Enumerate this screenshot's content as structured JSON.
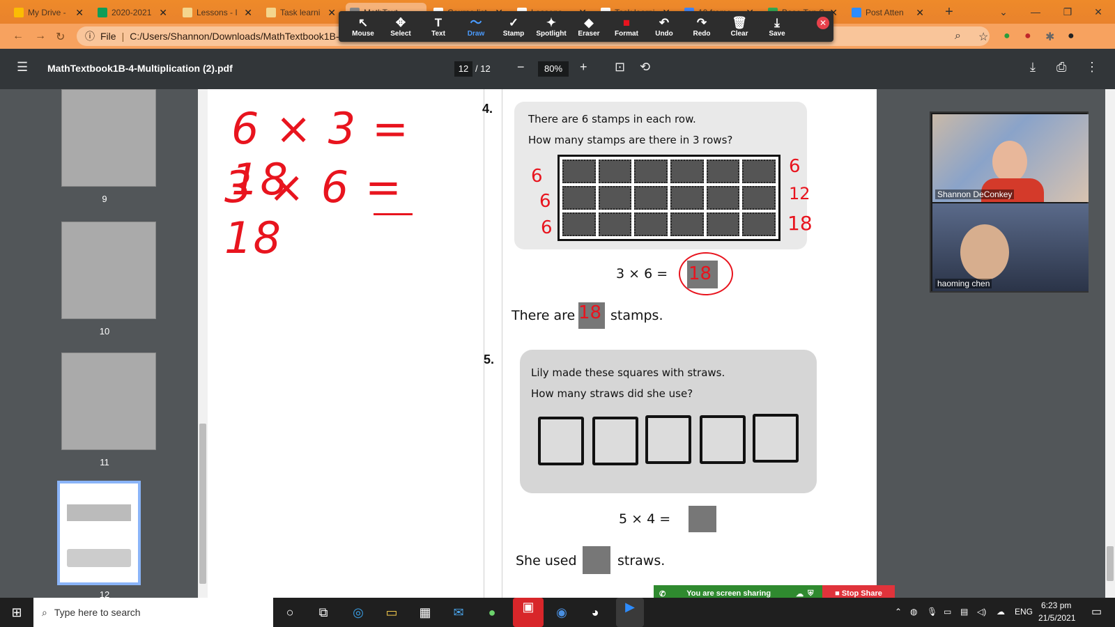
{
  "browser": {
    "tabs": [
      {
        "title": "My Drive -",
        "color": "#fbbc04"
      },
      {
        "title": "2020-2021",
        "color": "#0f9d58"
      },
      {
        "title": "Lessons - I",
        "color": "#f4d58d"
      },
      {
        "title": "Task learni",
        "color": "#f4d58d"
      },
      {
        "title": "MathText",
        "color": "#888888"
      },
      {
        "title": "Course list",
        "color": "#ffffff"
      },
      {
        "title": "Lessons",
        "color": "#ffffff"
      },
      {
        "title": "Task learni",
        "color": "#ffffff"
      },
      {
        "title": "10 frame",
        "color": "#4285f4"
      },
      {
        "title": "Base Ten S",
        "color": "#34a853"
      },
      {
        "title": "Post Atten",
        "color": "#2d8cff"
      }
    ],
    "address": "C:/Users/Shannon/Downloads/MathTextbook1B-4",
    "file_label": "File"
  },
  "annotation_toolbar": {
    "tools": [
      {
        "label": "Mouse",
        "icon": "↖"
      },
      {
        "label": "Select",
        "icon": "✥"
      },
      {
        "label": "Text",
        "icon": "T"
      },
      {
        "label": "Draw",
        "icon": "〜"
      },
      {
        "label": "Stamp",
        "icon": "✓"
      },
      {
        "label": "Spotlight",
        "icon": "✦"
      },
      {
        "label": "Eraser",
        "icon": "◆"
      },
      {
        "label": "Format",
        "icon": "■"
      },
      {
        "label": "Undo",
        "icon": "↶"
      },
      {
        "label": "Redo",
        "icon": "↷"
      },
      {
        "label": "Clear",
        "icon": "🗑"
      },
      {
        "label": "Save",
        "icon": "⤓"
      }
    ]
  },
  "pdf": {
    "filename": "MathTextbook1B-4-Multiplication (2).pdf",
    "current_page": "12",
    "total_pages": "/ 12",
    "zoom": "80%"
  },
  "thumbnails": [
    "9",
    "10",
    "11",
    "12"
  ],
  "whiteboard": {
    "line1": "6 × 3 = 18",
    "line2": "3 × 6 = 18"
  },
  "page": {
    "q4": {
      "number": "4.",
      "line1": "There are 6 stamps in each row.",
      "line2": "How many stamps are there in 3 rows?",
      "equation": "3  ×  6  =",
      "answer_written": "18",
      "sentence_before": "There are",
      "sentence_after": "stamps.",
      "left_marks": [
        "6",
        "6",
        "6"
      ],
      "right_marks": [
        "6",
        "12",
        "18"
      ]
    },
    "q5": {
      "number": "5.",
      "line1": "Lily made these squares with straws.",
      "line2": "How many straws did she use?",
      "equation": "5  ×  4  =",
      "sentence_before": "She used",
      "sentence_after": "straws."
    }
  },
  "zoom_meeting": {
    "participants": [
      "Shannon DeConkey",
      "haoming chen"
    ],
    "sharing_text": "You are screen sharing",
    "stop_share": "Stop Share"
  },
  "taskbar": {
    "search_placeholder": "Type here to search",
    "language": "ENG",
    "time": "6:23 pm",
    "date": "21/5/2021"
  }
}
